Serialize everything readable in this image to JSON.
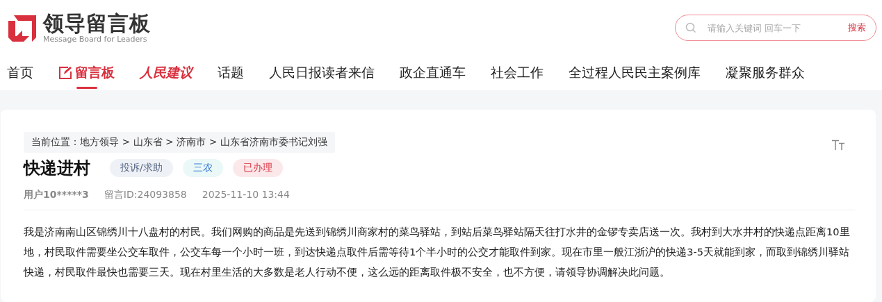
{
  "header": {
    "logo_title": "领导留言板",
    "logo_subtitle": "Message Board for Leaders",
    "search": {
      "placeholder": "请输入关键词 回车一下",
      "button": "搜索"
    }
  },
  "nav": [
    {
      "label": "首页",
      "kind": "text",
      "selected": false
    },
    {
      "label": "留言板",
      "kind": "edit",
      "selected": true
    },
    {
      "label": "人民建议",
      "kind": "brand",
      "selected": false
    },
    {
      "label": "话题",
      "kind": "text",
      "selected": false
    },
    {
      "label": "人民日报读者来信",
      "kind": "text",
      "selected": false
    },
    {
      "label": "政企直通车",
      "kind": "text",
      "selected": false
    },
    {
      "label": "社会工作",
      "kind": "text",
      "selected": false
    },
    {
      "label": "全过程人民民主案例库",
      "kind": "text",
      "selected": false
    },
    {
      "label": "凝聚服务群众",
      "kind": "text",
      "selected": false
    }
  ],
  "breadcrumb": "当前位置：地方领导 > 山东省 > 济南市 > 山东省济南市委书记刘强",
  "title": "快递进村",
  "tags": [
    {
      "label": "投诉/求助",
      "kind": "type"
    },
    {
      "label": "三农",
      "kind": "category"
    },
    {
      "label": "已办理",
      "kind": "status"
    }
  ],
  "meta": {
    "user": "用户10*****3",
    "message_id": "留言ID:24093858",
    "time": "2025-11-10 13:44"
  },
  "body": "我是济南南山区锦绣川十八盘村的村民。我们网购的商品是先送到锦绣川商家村的菜鸟驿站，到站后菜鸟驿站隔天往打水井的金锣专卖店送一次。我村到大水井村的快递点距离10里地，村民取件需要坐公交车取件，公交车每一个小时一班，到达快递点取件后需等待1个半小时的公交才能取件到家。现在市里一般江浙沪的快递3-5天就能到家，而取到锦绣川驿站快递，村民取件最快也需要三天。现在村里生活的大多数是老人行动不便，这么远的距离取件极不安全，也不方便，请领导协调解决此问题。"
}
